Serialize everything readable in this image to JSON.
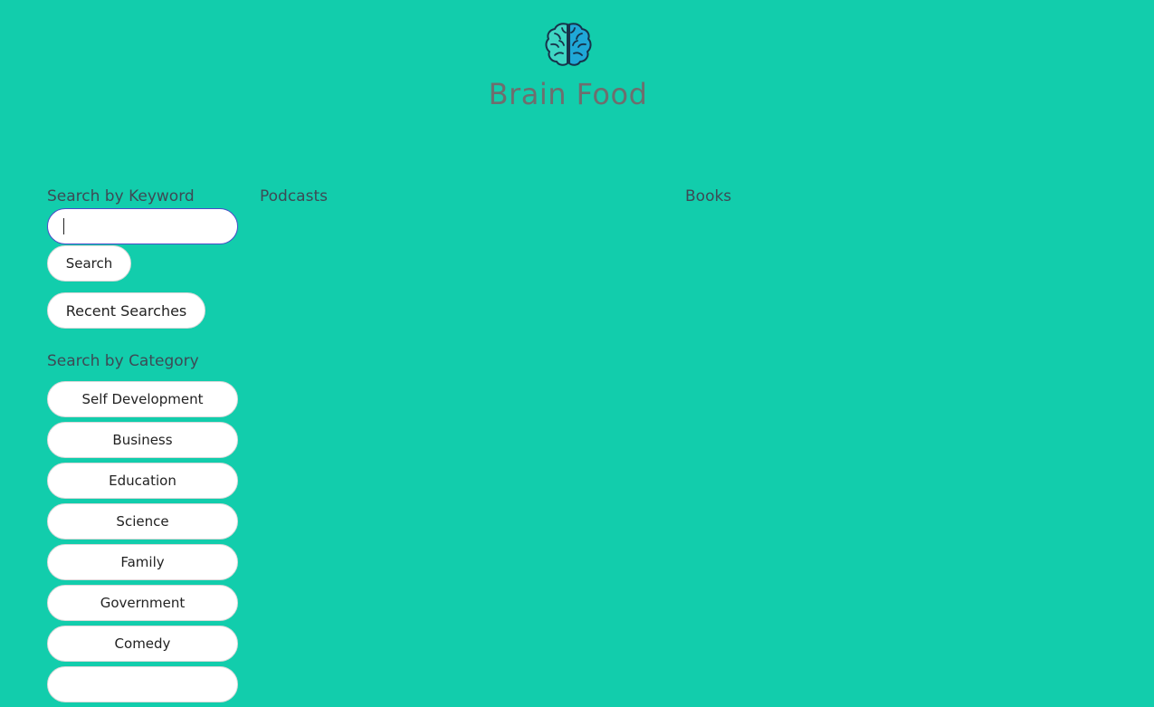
{
  "header": {
    "logo_icon": "brain-icon",
    "title": "Brain Food"
  },
  "sidebar": {
    "keyword_label": "Search by Keyword",
    "search_input_value": "",
    "search_button": "Search",
    "recent_button": "Recent Searches",
    "category_label": "Search by Category",
    "categories": [
      "Self Development",
      "Business",
      "Education",
      "Science",
      "Family",
      "Government",
      "Comedy",
      ""
    ]
  },
  "columns": {
    "podcasts": "Podcasts",
    "books": "Books"
  },
  "colors": {
    "background": "#12cdac",
    "title": "#6e6e6e",
    "input_border": "#4a4ac8"
  }
}
